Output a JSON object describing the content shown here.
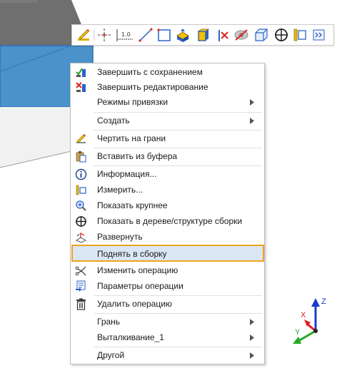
{
  "toolbar": {
    "items": [
      "sketch-on-face-icon",
      "axis-line-icon",
      "dimension-icon",
      "line-icon",
      "rectangle-icon",
      "extrude-icon",
      "box-icon",
      "split-icon",
      "hide-icon",
      "cube-icon",
      "snap-target-icon",
      "measure-icon",
      "expand-icon"
    ],
    "dimension_text": "1.0"
  },
  "menu": {
    "items": [
      {
        "label": "Завершить с сохранением",
        "icon": "finish-save-icon"
      },
      {
        "label": "Завершить редактирование",
        "icon": "finish-edit-icon"
      },
      {
        "label": "Режимы привязки",
        "icon": "",
        "submenu": true
      },
      {
        "label": "Создать",
        "icon": "",
        "submenu": true
      },
      {
        "label": "Чертить на грани",
        "icon": "sketch-on-face-icon"
      },
      {
        "label": "Вставить из буфера",
        "icon": "paste-icon"
      },
      {
        "label": "Информация...",
        "icon": "info-icon"
      },
      {
        "label": "Измерить...",
        "icon": "measure-icon"
      },
      {
        "label": "Показать крупнее",
        "icon": "zoom-in-icon"
      },
      {
        "label": "Показать в дереве/структуре сборки",
        "icon": "locate-in-tree-icon"
      },
      {
        "label": "Развернуть",
        "icon": "unfold-icon"
      },
      {
        "label": "Поднять в сборку",
        "icon": "",
        "highlighted": true
      },
      {
        "label": "Изменить операцию",
        "icon": "edit-operation-icon"
      },
      {
        "label": "Параметры операции",
        "icon": "operation-params-icon"
      },
      {
        "label": "Удалить операцию",
        "icon": "delete-icon"
      },
      {
        "label": "Грань",
        "icon": "",
        "submenu": true
      },
      {
        "label": "Выталкивание_1",
        "icon": "",
        "submenu": true
      },
      {
        "label": "Другой",
        "icon": "",
        "submenu": true
      }
    ]
  },
  "triad": {
    "x_label": "X",
    "y_label": "Y",
    "z_label": "Z"
  },
  "colors": {
    "selection_blue": "#3c8ed2",
    "highlight_border": "#f0a21b",
    "highlight_fill": "#dbe6f4",
    "axis_x": "#e02020",
    "axis_y": "#22aa22",
    "axis_z": "#1a3ccc"
  }
}
